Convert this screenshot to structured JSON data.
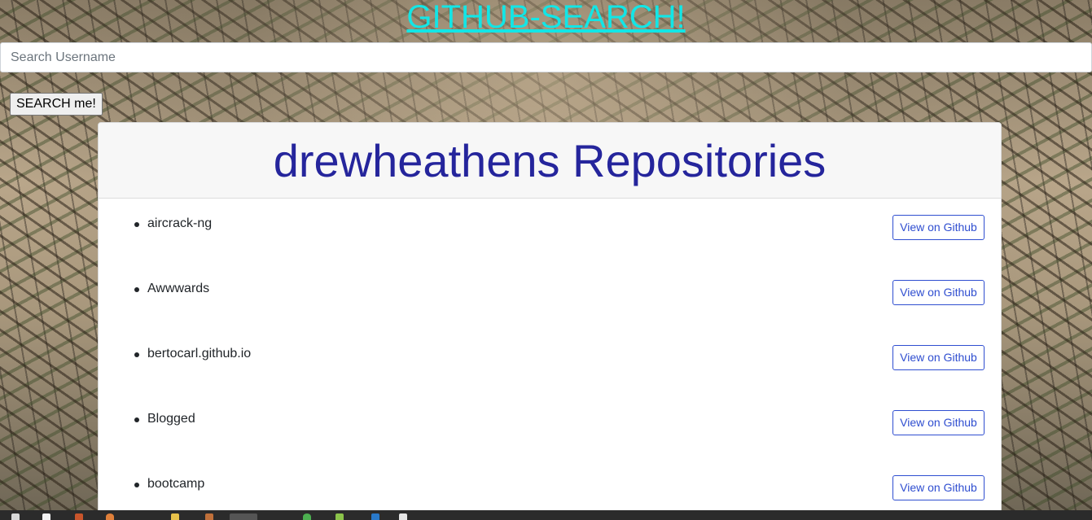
{
  "header": {
    "title": "GITHUB-SEARCH!"
  },
  "search": {
    "placeholder": "Search Username",
    "button_label": "SEARCH me!"
  },
  "repositories": {
    "heading": "drewheathens Repositories",
    "items": [
      {
        "name": "aircrack-ng",
        "button_label": "View on Github"
      },
      {
        "name": "Awwwards",
        "button_label": "View on Github"
      },
      {
        "name": "bertocarl.github.io",
        "button_label": "View on Github"
      },
      {
        "name": "Blogged",
        "button_label": "View on Github"
      },
      {
        "name": "bootcamp",
        "button_label": "View on Github"
      }
    ]
  },
  "colors": {
    "title_link": "#12e6e6",
    "heading_text": "#25259c",
    "button_accent": "#2f4ed0",
    "taskbar": "#2b2b2b"
  },
  "taskbar": {
    "icons": [
      "files-icon",
      "document-icon",
      "app-icon",
      "browser-icon",
      "folder-icon",
      "settings-icon",
      "active-app-icon",
      "chrome-icon",
      "android-icon",
      "editor-icon",
      "text-icon"
    ]
  }
}
